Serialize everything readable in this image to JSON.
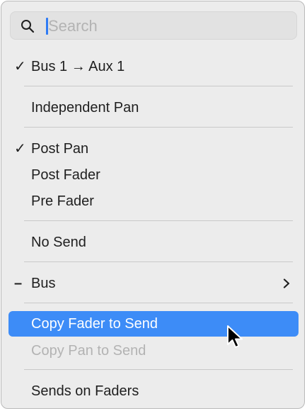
{
  "search": {
    "placeholder": "Search",
    "icon": "magnifying-glass-icon"
  },
  "menu": {
    "route": {
      "check": "✓",
      "label": "Bus 1 → Aux 1"
    },
    "independent_pan": {
      "label": "Independent Pan"
    },
    "post_pan": {
      "check": "✓",
      "label": "Post Pan"
    },
    "post_fader": {
      "label": "Post Fader"
    },
    "pre_fader": {
      "label": "Pre Fader"
    },
    "no_send": {
      "label": "No Send"
    },
    "bus": {
      "mark": "–",
      "label": "Bus",
      "submenu_icon": "chevron-right-icon"
    },
    "copy_fader_to_send": {
      "label": "Copy Fader to Send"
    },
    "copy_pan_to_send": {
      "label": "Copy Pan to Send"
    },
    "sends_on_faders": {
      "label": "Sends on Faders"
    }
  },
  "colors": {
    "highlight": "#3d8cf7",
    "caret": "#2f7bf5",
    "disabled_text": "#b3b3b3",
    "menu_background": "#ececec"
  },
  "cursor": {
    "icon": "mouse-pointer-icon"
  }
}
